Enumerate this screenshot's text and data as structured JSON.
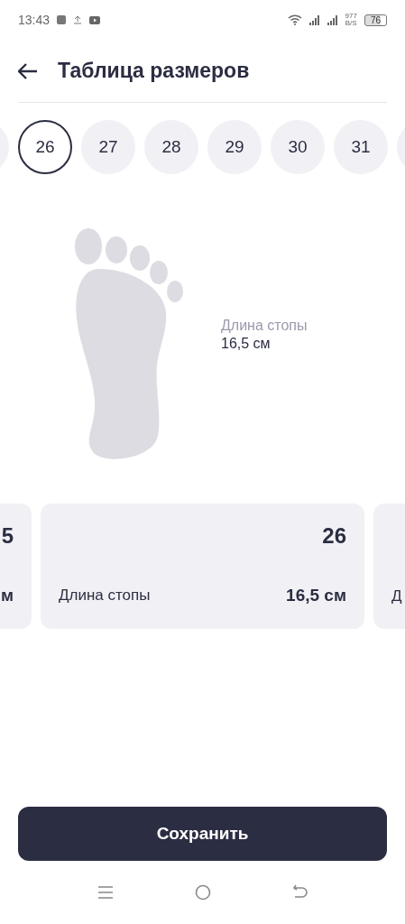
{
  "status_bar": {
    "time": "13:43",
    "speed": "977",
    "speed_unit": "B/S",
    "battery": "76"
  },
  "header": {
    "title": "Таблица размеров"
  },
  "sizes": [
    {
      "selected": false
    },
    {
      "label": "26",
      "selected": true
    },
    {
      "label": "27",
      "selected": false
    },
    {
      "label": "28",
      "selected": false
    },
    {
      "label": "29",
      "selected": false
    },
    {
      "label": "30",
      "selected": false
    },
    {
      "label": "31",
      "selected": false
    },
    {
      "selected": false
    }
  ],
  "foot": {
    "label": "Длина стопы",
    "value": "16,5 см"
  },
  "cards": [
    {
      "size": "5",
      "value": "м"
    },
    {
      "size": "26",
      "label": "Длина стопы",
      "value": "16,5 см"
    },
    {
      "label": "Д"
    }
  ],
  "save_button": "Сохранить"
}
